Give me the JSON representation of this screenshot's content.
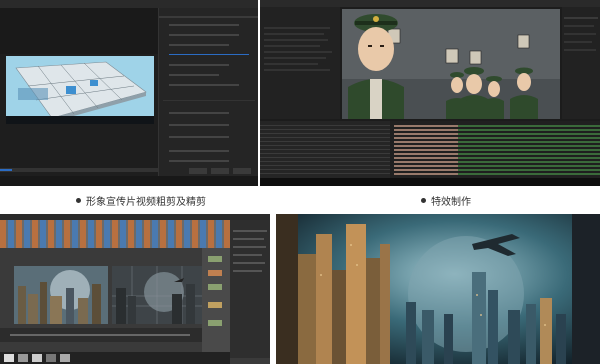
{
  "panels": {
    "top_left": {
      "caption": "形象宣传片视频粗剪及精剪"
    },
    "top_right": {
      "caption": "特效制作"
    }
  },
  "colors": {
    "app_bg": "#1e1e1e",
    "panel_bg": "#262626",
    "accent_blue": "#2b6cc4",
    "timeline_pink": "#c08080",
    "timeline_green": "#3a6a3a",
    "uniform_green": "#2f4a2c",
    "sky_teal": "#3a6a78"
  },
  "icons": [
    "bullet-icon"
  ]
}
